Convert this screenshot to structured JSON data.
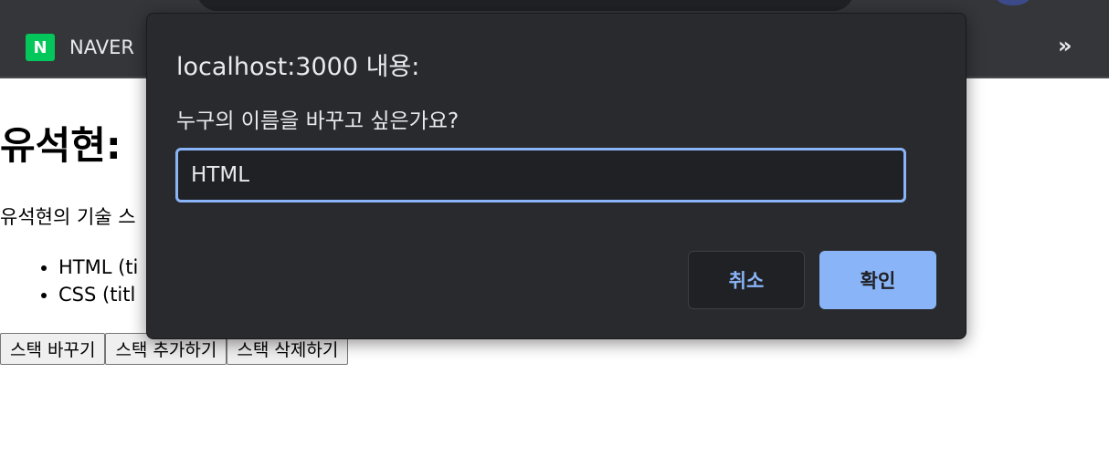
{
  "browser": {
    "bookmark_label": "NAVER",
    "bookmark_icon_letter": "N",
    "overflow_symbol": "»"
  },
  "page": {
    "heading": "유석현:",
    "description": "유석현의 기술 스",
    "stack_items": [
      "HTML (ti",
      "CSS (titl"
    ],
    "buttons": {
      "change": "스택 바꾸기",
      "add": "스택 추가하기",
      "delete": "스택 삭제하기"
    }
  },
  "dialog": {
    "title": "localhost:3000 내용:",
    "message": "누구의 이름을 바꾸고 싶은가요?",
    "input_value": "HTML",
    "cancel_label": "취소",
    "ok_label": "확인"
  },
  "colors": {
    "dialog_bg": "#292a2d",
    "accent": "#8ab4f8",
    "naver_green": "#03c75a"
  }
}
